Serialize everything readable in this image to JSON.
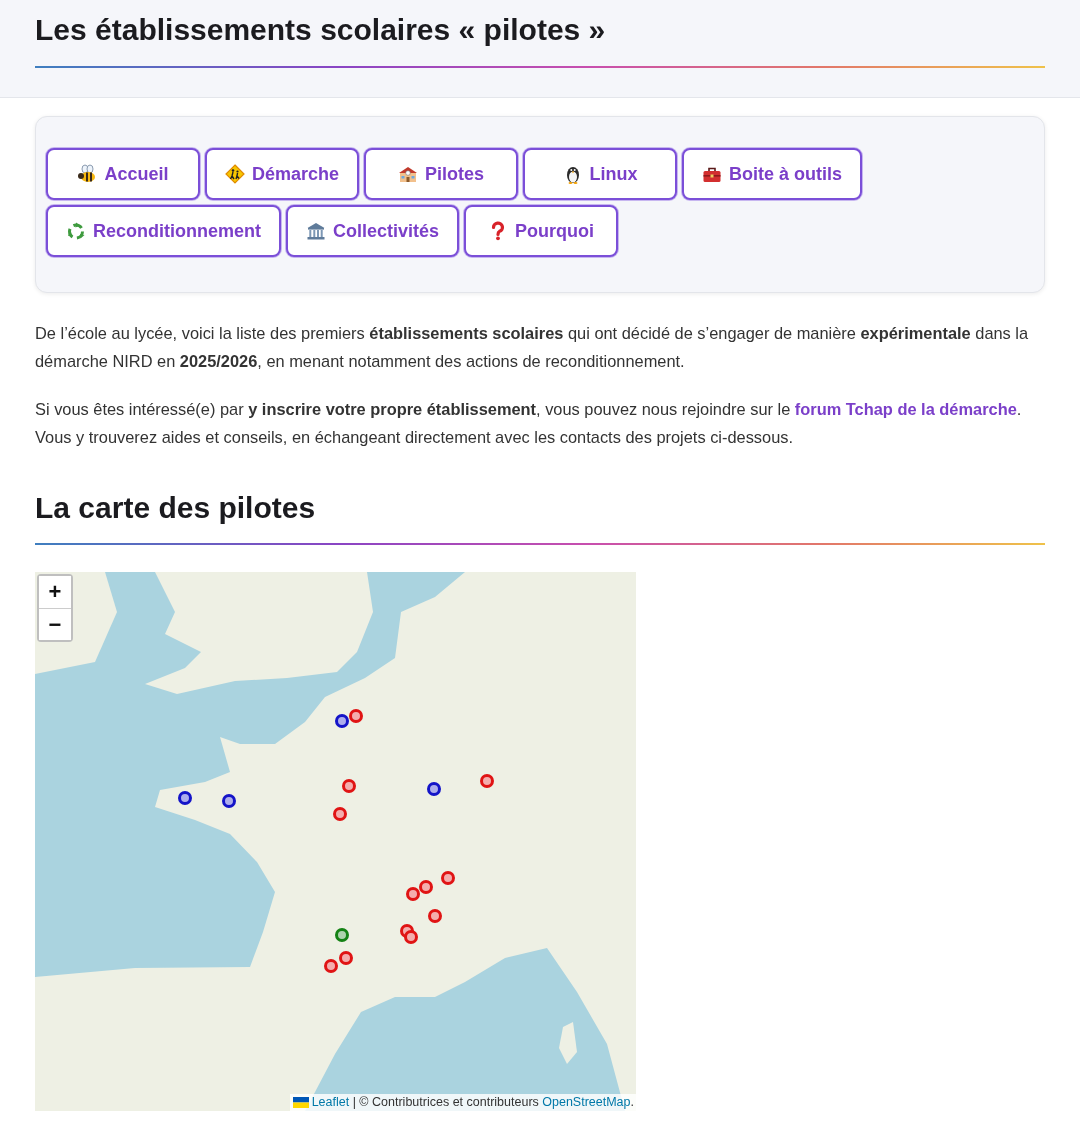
{
  "header": {
    "title": "Les établissements scolaires « pilotes »"
  },
  "nav_buttons": [
    "Accueil",
    "Démarche",
    "Pilotes",
    "Linux",
    "Boite à outils",
    "Reconditionnement",
    "Collectivités",
    "Pourquoi"
  ],
  "paragraphs": [
    {
      "text": "De l’école au lycée, voici la liste des premiers **établissements scolaires** qui ont décidé de s’engager de manière **expérimentale** dans la démarche NIRD en **2025/2026**, en menant notamment des actions de reconditionnement."
    },
    {
      "text": "Si vous êtes intéressé(e) par **y inscrire votre propre établissement**, vous pouvez nous rejoindre sur le ",
      "link": "forum Tchap de la démarche",
      "text_after": ". Vous y trouverez aides et conseils, en échangeant directement avec les contacts des projets ci-dessous."
    }
  ],
  "map_section": {
    "title": "La carte des pilotes",
    "zoom_controls": [
      "+",
      "−"
    ],
    "markers": [
      {
        "color": "#1414c8"
      },
      {
        "color": "#e01414"
      },
      {
        "color": "#e01414"
      },
      {
        "color": "#1414c8"
      },
      {
        "color": "#1414c8"
      },
      {
        "color": "#e01414"
      },
      {
        "color": "#1414c8"
      },
      {
        "color": "#e01414"
      },
      {
        "color": "#e01414"
      },
      {
        "color": "#e01414"
      },
      {
        "color": "#e01414"
      },
      {
        "color": "#e01414"
      },
      {
        "color": "#e01414"
      },
      {
        "color": "#e01414"
      },
      {
        "color": "#148214"
      },
      {
        "color": "#e01414"
      },
      {
        "color": "#e01414"
      }
    ],
    "attribution": {
      "link_1": "Leaflet",
      "text": " | © Contributrices et contributeurs ",
      "link_2": "OpenStreetMap",
      "end": "."
    }
  }
}
